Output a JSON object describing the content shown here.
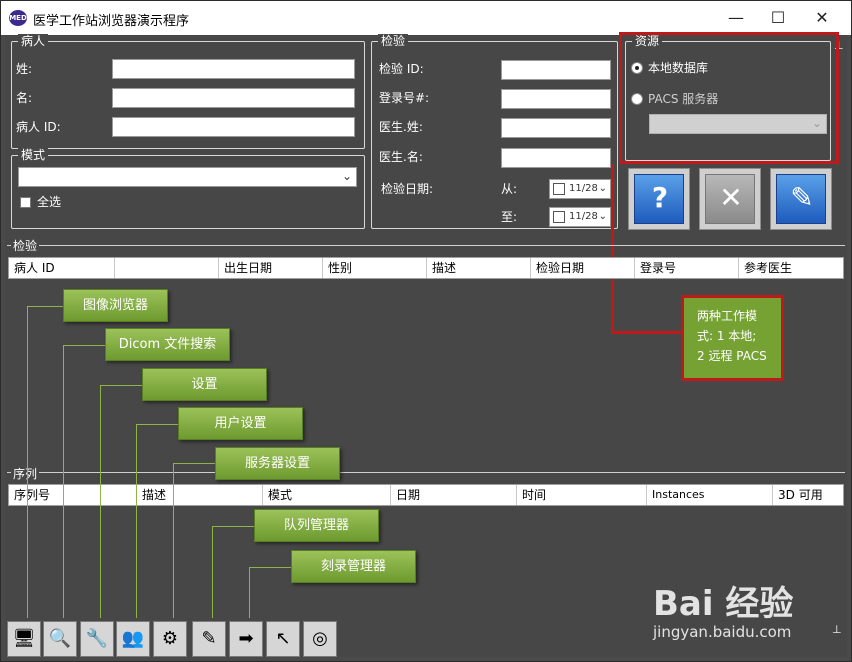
{
  "window": {
    "title": "医学工作站浏览器演示程序",
    "app_icon": "MED",
    "minimize": "—",
    "maximize": "☐",
    "close": "✕"
  },
  "patient": {
    "legend": "病人",
    "last_name_label": "姓:",
    "first_name_label": "名:",
    "id_label": "病人 ID:"
  },
  "modality": {
    "legend": "模式",
    "select_all_label": "全选"
  },
  "study": {
    "legend": "检验",
    "id_label": "检验 ID:",
    "accession_label": "登录号#:",
    "doctor_last_label": "医生.姓:",
    "doctor_first_label": "医生.名:",
    "date_label": "检验日期:",
    "from_label": "从:",
    "to_label": "至:",
    "from_value": "11/28",
    "to_value": "11/28"
  },
  "source": {
    "legend": "资源",
    "local_label": "本地数据库",
    "pacs_label": "PACS 服务器",
    "local_selected": true
  },
  "action_buttons": [
    {
      "icon": "query-icon",
      "glyph": "?"
    },
    {
      "icon": "clear-icon",
      "glyph": "✕"
    },
    {
      "icon": "edit-query-icon",
      "glyph": "✎"
    }
  ],
  "studies_table": {
    "title": "检验",
    "columns": [
      "病人 ID",
      "",
      "出生日期",
      "性别",
      "描述",
      "检验日期",
      "登录号",
      "参考医生"
    ]
  },
  "series_table": {
    "title": "序列",
    "columns": [
      "序列号",
      "描述",
      "模式",
      "日期",
      "时间",
      "Instances",
      "3D 可用"
    ]
  },
  "callouts": {
    "image_browser": "图像浏览器",
    "dicom_search": "Dicom 文件搜索",
    "settings": "设置",
    "user_settings": "用户设置",
    "server_settings": "服务器设置",
    "queue_manager": "队列管理器",
    "burn_manager": "刻录管理器",
    "work_modes_line1": "两种工作模",
    "work_modes_line2": "式: 1 本地;",
    "work_modes_line3": "2 远程 PACS"
  },
  "toolbar": [
    {
      "icon": "image-browser-icon",
      "glyph": "🖥"
    },
    {
      "icon": "search-icon",
      "glyph": "🔍"
    },
    {
      "icon": "wrench-icon",
      "glyph": "🔧"
    },
    {
      "icon": "users-icon",
      "glyph": "👥"
    },
    {
      "icon": "server-icon",
      "glyph": "⚙"
    },
    {
      "icon": "queue-icon",
      "glyph": "✎"
    },
    {
      "icon": "disc-icon",
      "glyph": "➡"
    },
    {
      "icon": "pointer-icon",
      "glyph": "↖"
    },
    {
      "icon": "globe-icon",
      "glyph": "◎"
    }
  ],
  "watermark": {
    "brand": "Bai 经验",
    "url": "jingyan.baidu.com"
  },
  "colors": {
    "window_bg": "#474747",
    "callout_green": "#7ba53a",
    "highlight_red": "#c0191c"
  }
}
